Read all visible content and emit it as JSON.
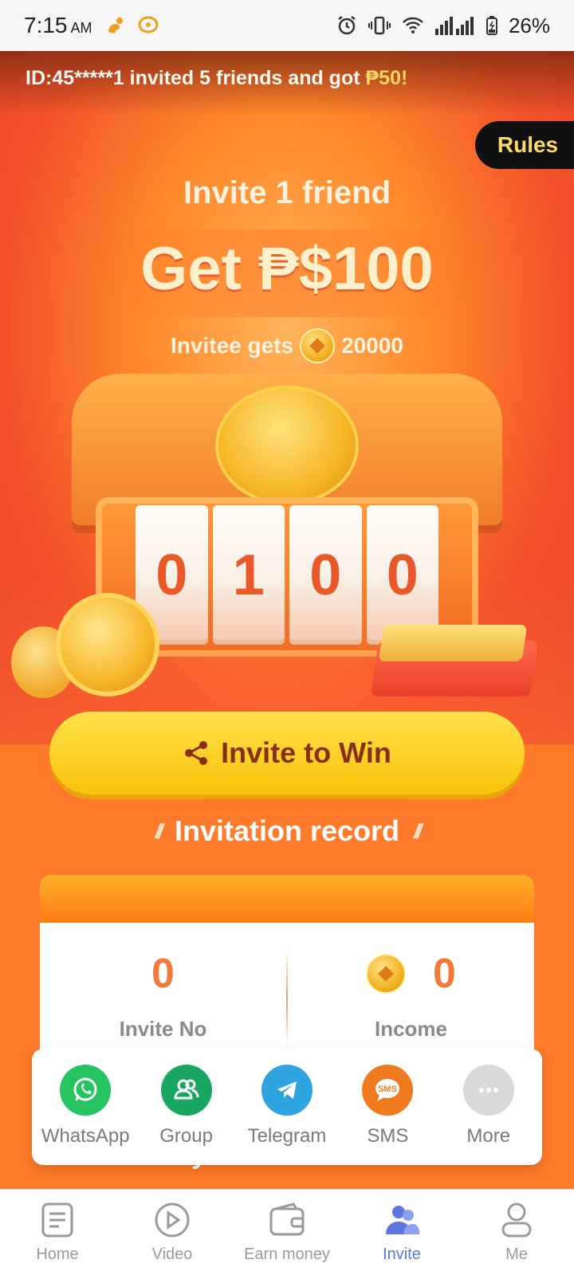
{
  "status_bar": {
    "time": "7:15",
    "ampm": "AM",
    "battery": "26%"
  },
  "ticker": {
    "text": "ID:45*****1 invited 5 friends and got ",
    "amount": "₱50!"
  },
  "rules_label": "Rules",
  "hero": {
    "subtitle": "Invite 1 friend",
    "title": "Get ₱$100",
    "note_prefix": "Invitee gets",
    "note_coins": "20000",
    "digits": [
      "0",
      "1",
      "0",
      "0"
    ]
  },
  "invite_button_label": "Invite to Win",
  "record": {
    "title": "Invitation record",
    "invite_no_value": "0",
    "invite_no_label": "Invite No",
    "income_value": "0",
    "income_label": "Income"
  },
  "peek_title": "My invitation code",
  "share": {
    "items": [
      {
        "label": "WhatsApp",
        "color": "#25c461"
      },
      {
        "label": "Group",
        "color": "#18a660"
      },
      {
        "label": "Telegram",
        "color": "#2ea3e0"
      },
      {
        "label": "SMS",
        "color": "#f07a1e"
      },
      {
        "label": "More",
        "color": "#d9d9d9"
      }
    ],
    "sms_text": "SMS"
  },
  "nav": {
    "items": [
      {
        "label": "Home"
      },
      {
        "label": "Video"
      },
      {
        "label": "Earn money"
      },
      {
        "label": "Invite"
      },
      {
        "label": "Me"
      }
    ],
    "active_color": "#5b74e0"
  }
}
